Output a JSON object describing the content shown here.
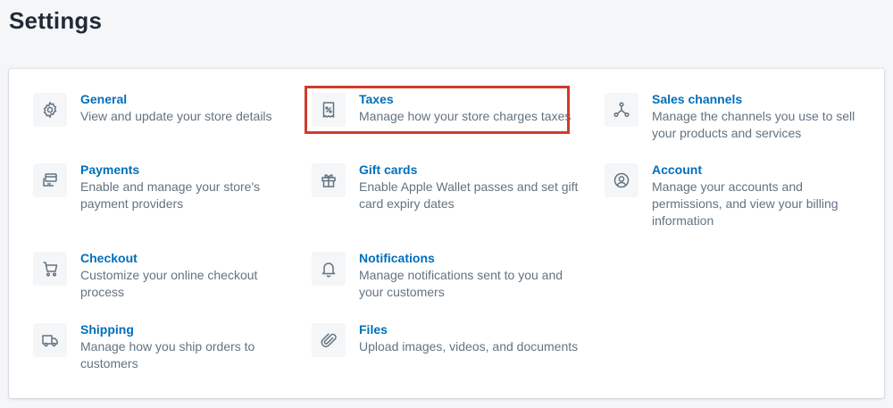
{
  "page": {
    "title": "Settings"
  },
  "settings": {
    "general": {
      "title": "General",
      "desc": [
        "View and update your store details"
      ],
      "icon": "gear-icon"
    },
    "taxes": {
      "title": "Taxes",
      "desc": [
        "Manage how your store charges taxes"
      ],
      "icon": "tax-receipt-icon"
    },
    "sales_channels": {
      "title": "Sales channels",
      "desc": [
        "Manage the channels you use to sell",
        "your products and services"
      ],
      "icon": "sales-channels-icon"
    },
    "payments": {
      "title": "Payments",
      "desc": [
        "Enable and manage your store's",
        "payment providers"
      ],
      "icon": "payments-icon"
    },
    "gift_cards": {
      "title": "Gift cards",
      "desc": [
        "Enable Apple Wallet passes and set gift",
        "card expiry dates"
      ],
      "icon": "gift-icon"
    },
    "account": {
      "title": "Account",
      "desc": [
        "Manage your accounts and",
        "permissions, and view your billing",
        "information"
      ],
      "icon": "account-icon"
    },
    "checkout": {
      "title": "Checkout",
      "desc": [
        "Customize your online checkout",
        "process"
      ],
      "icon": "cart-icon"
    },
    "notifications": {
      "title": "Notifications",
      "desc": [
        "Manage notifications sent to you and",
        "your customers"
      ],
      "icon": "bell-icon"
    },
    "shipping": {
      "title": "Shipping",
      "desc": [
        "Manage how you ship orders to",
        "customers"
      ],
      "icon": "truck-icon"
    },
    "files": {
      "title": "Files",
      "desc": [
        "Upload images, videos, and documents"
      ],
      "icon": "paperclip-icon"
    }
  },
  "colors": {
    "link": "#006fbb",
    "description": "#637381",
    "icon": "#637381",
    "icon_bg": "#f4f6f8",
    "highlight": "#d23b2b"
  }
}
